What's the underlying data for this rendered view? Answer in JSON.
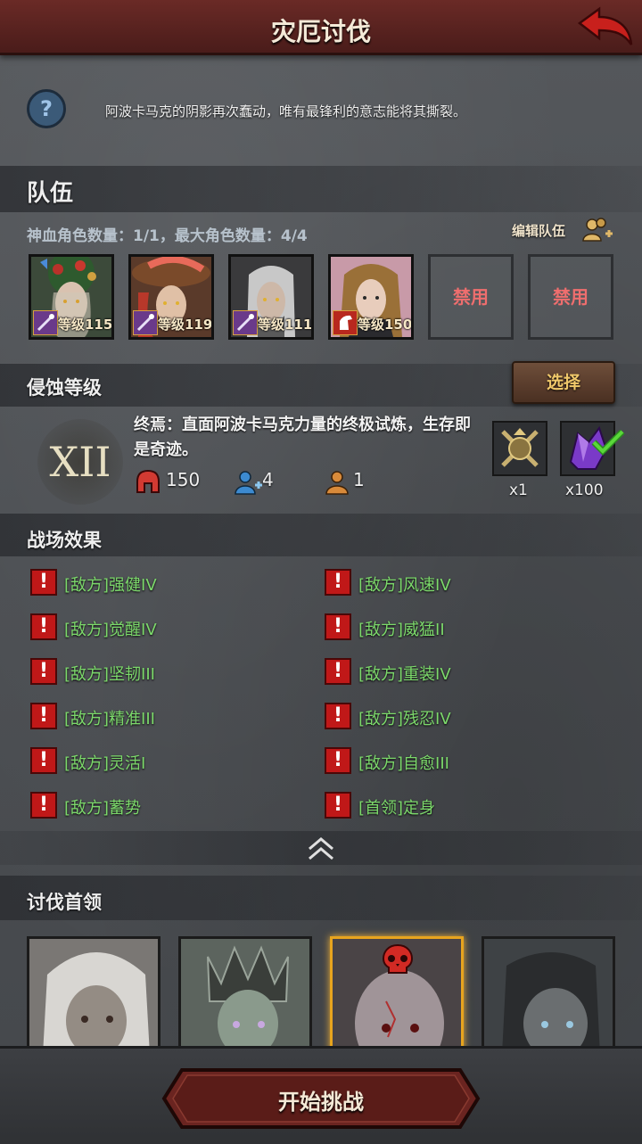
{
  "header": {
    "title": "灾厄讨伐",
    "back_icon": "back-arrow-icon"
  },
  "intro": {
    "help_icon": "question-icon",
    "text": "阿波卡马克的阴影再次蠢动，唯有最锋利的意志能将其撕裂。"
  },
  "team": {
    "title": "队伍",
    "count_text": "神血角色数量：1/1，最大角色数量：4/4",
    "edit_label": "编辑队伍",
    "heroes": [
      {
        "level": "等级115",
        "class_icon": "wand-icon"
      },
      {
        "level": "等级119",
        "class_icon": "wand-icon"
      },
      {
        "level": "等级111",
        "class_icon": "wand-icon"
      },
      {
        "level": "等级150",
        "class_icon": "horse-icon"
      }
    ],
    "disabled_slots": [
      "禁用",
      "禁用"
    ]
  },
  "corrosion": {
    "title": "侵蚀等级",
    "select_label": "选择",
    "level": "XII",
    "description": "终焉：直面阿波卡马克力量的终极试炼，生存即是奇迹。",
    "stats": {
      "power": "150",
      "members": "4",
      "divine": "1"
    },
    "rewards": [
      {
        "icon": "crossed-weapons-emblem-icon",
        "count": "x1"
      },
      {
        "icon": "purple-crystal-icon",
        "count": "x100",
        "checked": true
      }
    ]
  },
  "effects": {
    "title": "战场效果",
    "left": [
      "[敌方]强健IV",
      "[敌方]觉醒IV",
      "[敌方]坚韧III",
      "[敌方]精准III",
      "[敌方]灵活I",
      "[敌方]蓄势"
    ],
    "right": [
      "[敌方]风速IV",
      "[敌方]威猛II",
      "[敌方]重装IV",
      "[敌方]残忍IV",
      "[敌方]自愈III",
      "[首领]定身"
    ],
    "alert_glyph": "!"
  },
  "bosses": {
    "title": "讨伐首领",
    "selected_index": 2
  },
  "footer": {
    "start_label": "开始挑战"
  },
  "colors": {
    "accent": "#e8a41e",
    "effect_text": "#7cd96b",
    "header": "#5a2220",
    "disabled": "#ef6e6e"
  }
}
